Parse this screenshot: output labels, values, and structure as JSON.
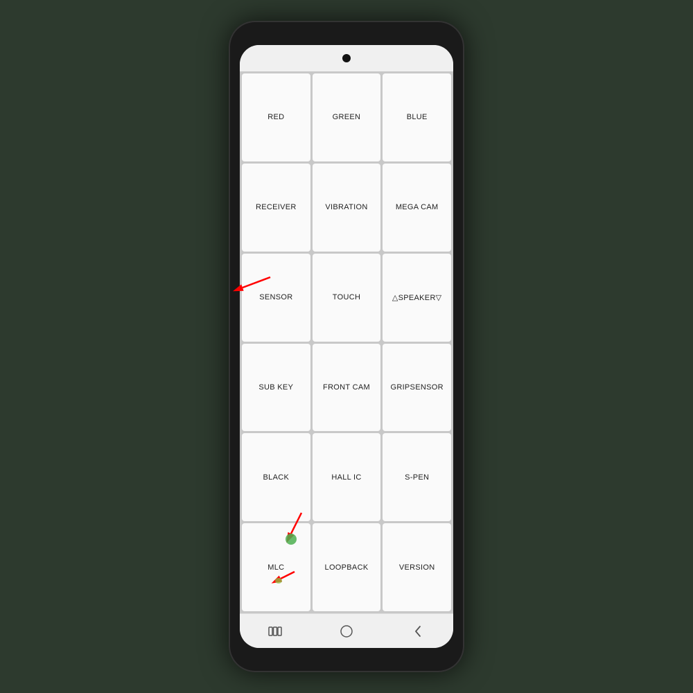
{
  "phone": {
    "grid": {
      "cells": [
        {
          "id": "red",
          "label": "RED"
        },
        {
          "id": "green",
          "label": "GREEN"
        },
        {
          "id": "blue",
          "label": "BLUE"
        },
        {
          "id": "receiver",
          "label": "RECEIVER"
        },
        {
          "id": "vibration",
          "label": "VIBRATION"
        },
        {
          "id": "mega-cam",
          "label": "MEGA CAM"
        },
        {
          "id": "sensor",
          "label": "SENSOR"
        },
        {
          "id": "touch",
          "label": "TOUCH"
        },
        {
          "id": "speaker",
          "label": "△SPEAKER▽"
        },
        {
          "id": "sub-key",
          "label": "SUB KEY"
        },
        {
          "id": "front-cam",
          "label": "FRONT CAM"
        },
        {
          "id": "gripsensor",
          "label": "GRIPSENSOR"
        },
        {
          "id": "black",
          "label": "BLACK"
        },
        {
          "id": "hall-ic",
          "label": "HALL IC"
        },
        {
          "id": "s-pen",
          "label": "S-PEN"
        },
        {
          "id": "mlc",
          "label": "MLC"
        },
        {
          "id": "loopback",
          "label": "LOOPBACK"
        },
        {
          "id": "version",
          "label": "VERSION"
        }
      ]
    },
    "nav": {
      "recent_icon": "|||",
      "home_icon": "○",
      "back_icon": "<"
    }
  }
}
